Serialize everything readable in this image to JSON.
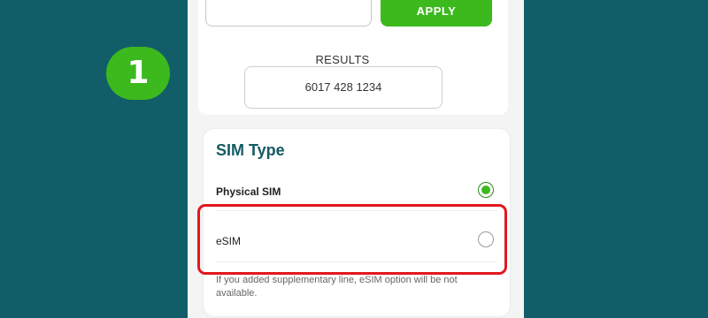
{
  "step": {
    "number": "1"
  },
  "promo": {
    "input_value": "",
    "apply_label": "APPLY"
  },
  "results": {
    "label": "RESULTS",
    "value": "6017 428 1234"
  },
  "sim_type": {
    "title": "SIM Type",
    "options": [
      {
        "label": "Physical SIM",
        "selected": true
      },
      {
        "label": "eSIM",
        "selected": false
      }
    ],
    "note": "If you added supplementary line, eSIM option will be not available."
  },
  "colors": {
    "background": "#125e68",
    "accent_green": "#3cb91d",
    "title_teal": "#155a63",
    "highlight_red": "#e2171e"
  }
}
